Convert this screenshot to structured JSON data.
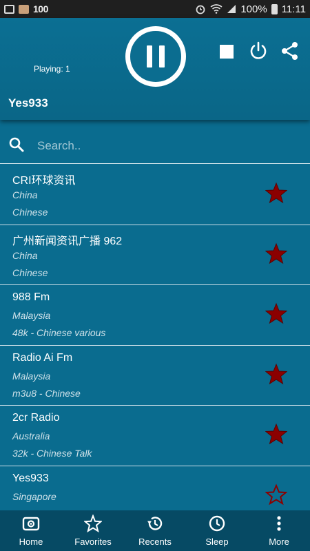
{
  "status_bar": {
    "left_text": "100",
    "battery": "100%",
    "time": "11:11"
  },
  "header": {
    "playing_label": "Playing: 1",
    "station_title": "Yes933",
    "icons": [
      "pause-icon",
      "stop-icon",
      "power-icon",
      "share-icon"
    ]
  },
  "search": {
    "placeholder": "Search.."
  },
  "stations": [
    {
      "name": "CRI环球资讯",
      "country": "China",
      "info": "Chinese",
      "favorite": true
    },
    {
      "name": "广州新闻资讯广播 962",
      "country": "China",
      "info": "Chinese",
      "favorite": true
    },
    {
      "name": "988 Fm",
      "country": "Malaysia",
      "info": "48k - Chinese various",
      "favorite": true
    },
    {
      "name": "Radio Ai Fm",
      "country": "Malaysia",
      "info": "m3u8 - Chinese",
      "favorite": true
    },
    {
      "name": "2cr Radio",
      "country": "Australia",
      "info": "32k - Chinese Talk",
      "favorite": true
    },
    {
      "name": "Yes933",
      "country": "Singapore",
      "info": "",
      "favorite": false
    }
  ],
  "nav": [
    {
      "label": "Home",
      "icon": "radio-icon"
    },
    {
      "label": "Favorites",
      "icon": "star-outline-icon"
    },
    {
      "label": "Recents",
      "icon": "history-icon"
    },
    {
      "label": "Sleep",
      "icon": "clock-icon"
    },
    {
      "label": "More",
      "icon": "more-vert-icon"
    }
  ],
  "colors": {
    "background": "#0a6c8f",
    "nav": "#064a64",
    "star": "#8b0000"
  }
}
